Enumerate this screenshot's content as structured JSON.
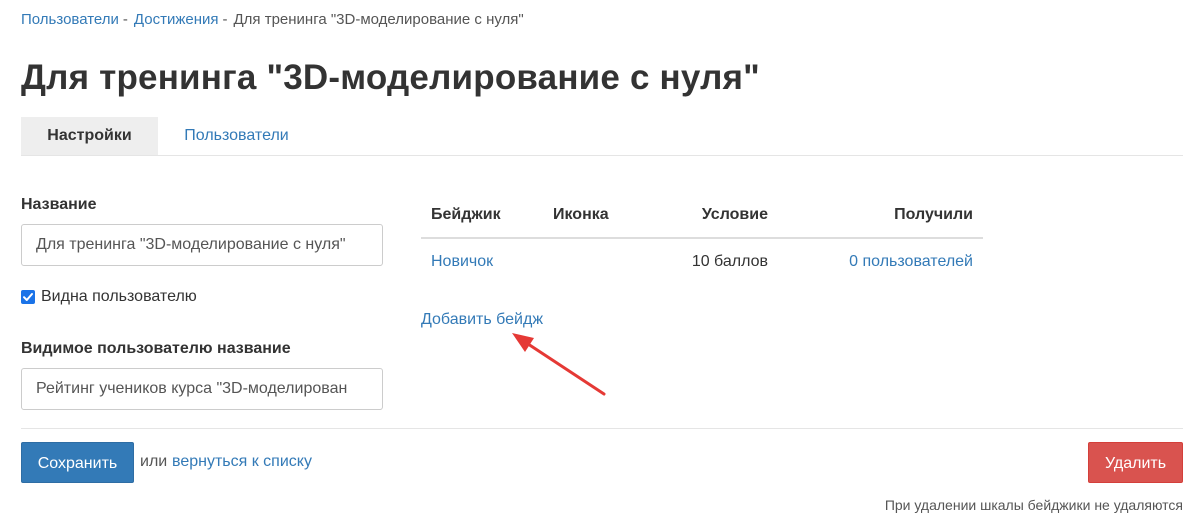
{
  "breadcrumb": {
    "items": [
      "Пользователи",
      "Достижения"
    ],
    "separator": "-",
    "current": "Для тренинга \"3D-моделирование с нуля\""
  },
  "page_title": "Для тренинга \"3D-моделирование с нуля\"",
  "tabs": [
    {
      "label": "Настройки",
      "active": true
    },
    {
      "label": "Пользователи",
      "active": false
    }
  ],
  "form": {
    "name_label": "Название",
    "name_value": "Для тренинга \"3D-моделирование с нуля\"",
    "visible_checkbox_label": "Видна пользователю",
    "visible_checked": true,
    "visible_name_label": "Видимое пользователю название",
    "visible_name_value": "Рейтинг учеников курса \"3D-моделирован"
  },
  "badges_table": {
    "columns": [
      "Бейджик",
      "Иконка",
      "Условие",
      "Получили"
    ],
    "rows": [
      {
        "badge": "Новичок",
        "icon": "",
        "condition": "10 баллов",
        "received": "0 пользователей"
      }
    ]
  },
  "add_badge_label": "Добавить бейдж",
  "annotation": {
    "type": "arrow",
    "color": "#e53935",
    "points_to": "add-badge-link"
  },
  "footer": {
    "save_label": "Сохранить",
    "or_text": "или",
    "back_link_label": "вернуться к списку",
    "delete_label": "Удалить",
    "delete_hint": "При удалении шкалы бейджики не удаляются"
  },
  "colors": {
    "link": "#337ab7",
    "primary": "#337ab7",
    "danger": "#d9534f",
    "checkbox": "#1a73e8"
  }
}
